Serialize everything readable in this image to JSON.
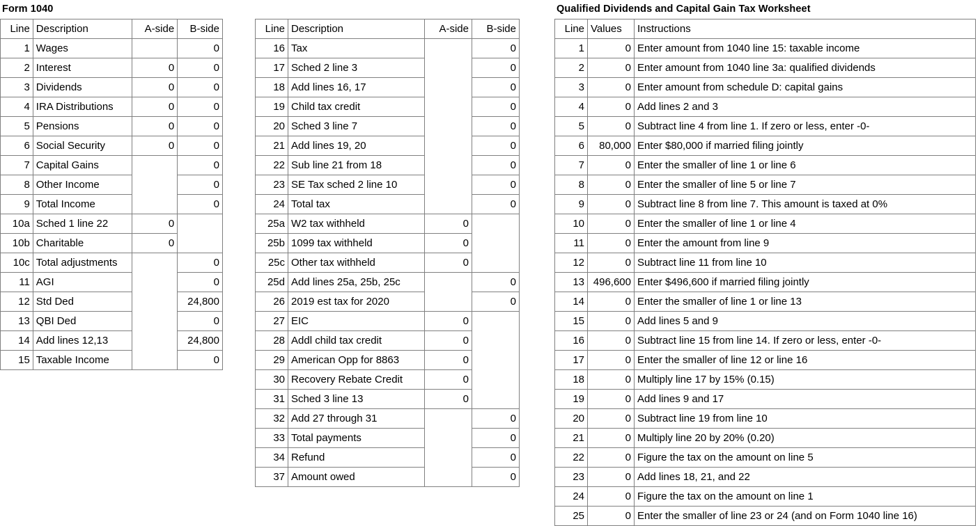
{
  "colors": {
    "gray_fill": "#BFBFBF",
    "cream_fill": "#FFEFC9",
    "border": "#808080",
    "background": "#FFFFFF",
    "text": "#000000"
  },
  "form_1040_a": {
    "title": "Form 1040",
    "columns": [
      "Line",
      "Description",
      "A-side",
      "B-side"
    ],
    "rows": [
      {
        "line": "1",
        "desc": "Wages",
        "a": null,
        "a_fill": "none",
        "b": "0",
        "b_fill": "gray"
      },
      {
        "line": "2",
        "desc": "Interest",
        "a": "0",
        "a_fill": "gray",
        "b": "0",
        "b_fill": "gray"
      },
      {
        "line": "3",
        "desc": "Dividends",
        "a": "0",
        "a_fill": "cream",
        "b": "0",
        "b_fill": "cream"
      },
      {
        "line": "4",
        "desc": "IRA Distributions",
        "a": "0",
        "a_fill": "gray",
        "b": "0",
        "b_fill": "cream"
      },
      {
        "line": "5",
        "desc": "Pensions",
        "a": "0",
        "a_fill": "gray",
        "b": "0",
        "b_fill": "gray"
      },
      {
        "line": "6",
        "desc": "Social Security",
        "a": "0",
        "a_fill": "gray",
        "b": "0",
        "b_fill": "gray"
      },
      {
        "line": "7",
        "desc": "Capital Gains",
        "a": null,
        "a_fill": "none",
        "b": "0",
        "b_fill": "cream"
      },
      {
        "line": "8",
        "desc": "Other Income",
        "a": null,
        "a_fill": "none",
        "b": "0",
        "b_fill": "gray"
      },
      {
        "line": "9",
        "desc": "Total Income",
        "a": null,
        "a_fill": "none",
        "b": "0",
        "b_fill": "gray"
      },
      {
        "line": "10a",
        "desc": "Sched 1 line 22",
        "a": "0",
        "a_fill": "gray",
        "b": null,
        "b_fill": "none"
      },
      {
        "line": "10b",
        "desc": "Charitable",
        "a": "0",
        "a_fill": "cream",
        "b": null,
        "b_fill": "none"
      },
      {
        "line": "10c",
        "desc": "Total adjustments",
        "a": null,
        "a_fill": "none",
        "b": "0",
        "b_fill": "gray"
      },
      {
        "line": "11",
        "desc": "AGI",
        "a": null,
        "a_fill": "none",
        "b": "0",
        "b_fill": "gray"
      },
      {
        "line": "12",
        "desc": "Std Ded",
        "a": null,
        "a_fill": "none",
        "b": "24,800",
        "b_fill": "gray"
      },
      {
        "line": "13",
        "desc": "QBI Ded",
        "a": null,
        "a_fill": "none",
        "b": "0",
        "b_fill": "gray"
      },
      {
        "line": "14",
        "desc": "Add lines 12,13",
        "a": null,
        "a_fill": "none",
        "b": "24,800",
        "b_fill": "gray"
      },
      {
        "line": "15",
        "desc": "Taxable Income",
        "a": null,
        "a_fill": "none",
        "b": "0",
        "b_fill": "gray"
      }
    ]
  },
  "form_1040_b": {
    "title": "",
    "columns": [
      "Line",
      "Description",
      "A-side",
      "B-side"
    ],
    "rows": [
      {
        "line": "16",
        "desc": "Tax",
        "a": null,
        "a_fill": "none",
        "b": "0",
        "b_fill": "gray"
      },
      {
        "line": "17",
        "desc": "Sched 2 line 3",
        "a": null,
        "a_fill": "none",
        "b": "0",
        "b_fill": "gray"
      },
      {
        "line": "18",
        "desc": "Add lines 16, 17",
        "a": null,
        "a_fill": "none",
        "b": "0",
        "b_fill": "gray"
      },
      {
        "line": "19",
        "desc": "Child tax credit",
        "a": null,
        "a_fill": "none",
        "b": "0",
        "b_fill": "gray"
      },
      {
        "line": "20",
        "desc": "Sched 3 line 7",
        "a": null,
        "a_fill": "none",
        "b": "0",
        "b_fill": "cream"
      },
      {
        "line": "21",
        "desc": "Add lines 19, 20",
        "a": null,
        "a_fill": "none",
        "b": "0",
        "b_fill": "gray"
      },
      {
        "line": "22",
        "desc": "Sub line 21 from 18",
        "a": null,
        "a_fill": "none",
        "b": "0",
        "b_fill": "gray"
      },
      {
        "line": "23",
        "desc": "SE Tax sched 2 line 10",
        "a": null,
        "a_fill": "none",
        "b": "0",
        "b_fill": "gray"
      },
      {
        "line": "24",
        "desc": "Total tax",
        "a": null,
        "a_fill": "none",
        "b": "0",
        "b_fill": "gray"
      },
      {
        "line": "25a",
        "desc": "W2 tax withheld",
        "a": "0",
        "a_fill": "gray",
        "b": null,
        "b_fill": "none"
      },
      {
        "line": "25b",
        "desc": "1099 tax withheld",
        "a": "0",
        "a_fill": "gray",
        "b": null,
        "b_fill": "none"
      },
      {
        "line": "25c",
        "desc": "Other tax withheld",
        "a": "0",
        "a_fill": "gray",
        "b": null,
        "b_fill": "none"
      },
      {
        "line": "25d",
        "desc": "Add lines 25a, 25b, 25c",
        "a": null,
        "a_fill": "none",
        "b": "0",
        "b_fill": "gray"
      },
      {
        "line": "26",
        "desc": "2019 est tax for 2020",
        "a": null,
        "a_fill": "none",
        "b": "0",
        "b_fill": "gray"
      },
      {
        "line": "27",
        "desc": "EIC",
        "a": "0",
        "a_fill": "gray",
        "b": null,
        "b_fill": "none"
      },
      {
        "line": "28",
        "desc": "Addl child tax credit",
        "a": "0",
        "a_fill": "gray",
        "b": null,
        "b_fill": "none"
      },
      {
        "line": "29",
        "desc": "American Opp for 8863",
        "a": "0",
        "a_fill": "gray",
        "b": null,
        "b_fill": "none"
      },
      {
        "line": "30",
        "desc": "Recovery Rebate Credit",
        "a": "0",
        "a_fill": "cream",
        "b": null,
        "b_fill": "none"
      },
      {
        "line": "31",
        "desc": "Sched 3 line 13",
        "a": "0",
        "a_fill": "gray",
        "b": null,
        "b_fill": "none"
      },
      {
        "line": "32",
        "desc": "Add 27 through 31",
        "a": null,
        "a_fill": "none",
        "b": "0",
        "b_fill": "gray"
      },
      {
        "line": "33",
        "desc": "Total payments",
        "a": null,
        "a_fill": "none",
        "b": "0",
        "b_fill": "gray"
      },
      {
        "line": "34",
        "desc": "Refund",
        "a": null,
        "a_fill": "none",
        "b": "0",
        "b_fill": "gray"
      },
      {
        "line": "37",
        "desc": "Amount owed",
        "a": null,
        "a_fill": "none",
        "b": "0",
        "b_fill": "gray"
      }
    ]
  },
  "qdcg_worksheet": {
    "title": "Qualified Dividends and Capital Gain Tax Worksheet",
    "columns": [
      "Line",
      "Values",
      "Instructions"
    ],
    "rows": [
      {
        "line": "1",
        "value": "0",
        "instruction": "Enter amount from 1040 line 15: taxable income"
      },
      {
        "line": "2",
        "value": "0",
        "instruction": "Enter amount from 1040 line 3a: qualified dividends"
      },
      {
        "line": "3",
        "value": "0",
        "instruction": "Enter amount from schedule D: capital gains"
      },
      {
        "line": "4",
        "value": "0",
        "instruction": "Add lines 2 and 3"
      },
      {
        "line": "5",
        "value": "0",
        "instruction": "Subtract line 4 from line 1. If zero or less, enter -0-"
      },
      {
        "line": "6",
        "value": "80,000",
        "instruction": "Enter $80,000 if married filing jointly"
      },
      {
        "line": "7",
        "value": "0",
        "instruction": "Enter the smaller of line 1 or line 6"
      },
      {
        "line": "8",
        "value": "0",
        "instruction": "Enter the smaller of line 5 or line 7"
      },
      {
        "line": "9",
        "value": "0",
        "instruction": "Subtract line 8 from line 7. This amount is taxed at 0%"
      },
      {
        "line": "10",
        "value": "0",
        "instruction": "Enter the smaller of line 1 or line 4"
      },
      {
        "line": "11",
        "value": "0",
        "instruction": "Enter the amount from line 9"
      },
      {
        "line": "12",
        "value": "0",
        "instruction": "Subtract line 11 from line 10"
      },
      {
        "line": "13",
        "value": "496,600",
        "instruction": "Enter $496,600 if married filing jointly"
      },
      {
        "line": "14",
        "value": "0",
        "instruction": "Enter the smaller of line 1 or line 13"
      },
      {
        "line": "15",
        "value": "0",
        "instruction": "Add lines 5 and 9"
      },
      {
        "line": "16",
        "value": "0",
        "instruction": "Subtract line 15 from line 14. If zero or less, enter -0-"
      },
      {
        "line": "17",
        "value": "0",
        "instruction": "Enter the smaller of line 12 or line 16"
      },
      {
        "line": "18",
        "value": "0",
        "instruction": "Multiply line 17 by 15% (0.15)"
      },
      {
        "line": "19",
        "value": "0",
        "instruction": "Add lines 9 and 17"
      },
      {
        "line": "20",
        "value": "0",
        "instruction": "Subtract line 19 from line 10"
      },
      {
        "line": "21",
        "value": "0",
        "instruction": "Multiply line 20 by 20% (0.20)"
      },
      {
        "line": "22",
        "value": "0",
        "instruction": "Figure the tax on the amount on line 5"
      },
      {
        "line": "23",
        "value": "0",
        "instruction": "Add lines 18, 21, and 22"
      },
      {
        "line": "24",
        "value": "0",
        "instruction": "Figure the tax on the amount on line 1"
      },
      {
        "line": "25",
        "value": "0",
        "instruction": "Enter the smaller of line 23 or 24 (and on Form 1040 line 16)"
      }
    ]
  }
}
